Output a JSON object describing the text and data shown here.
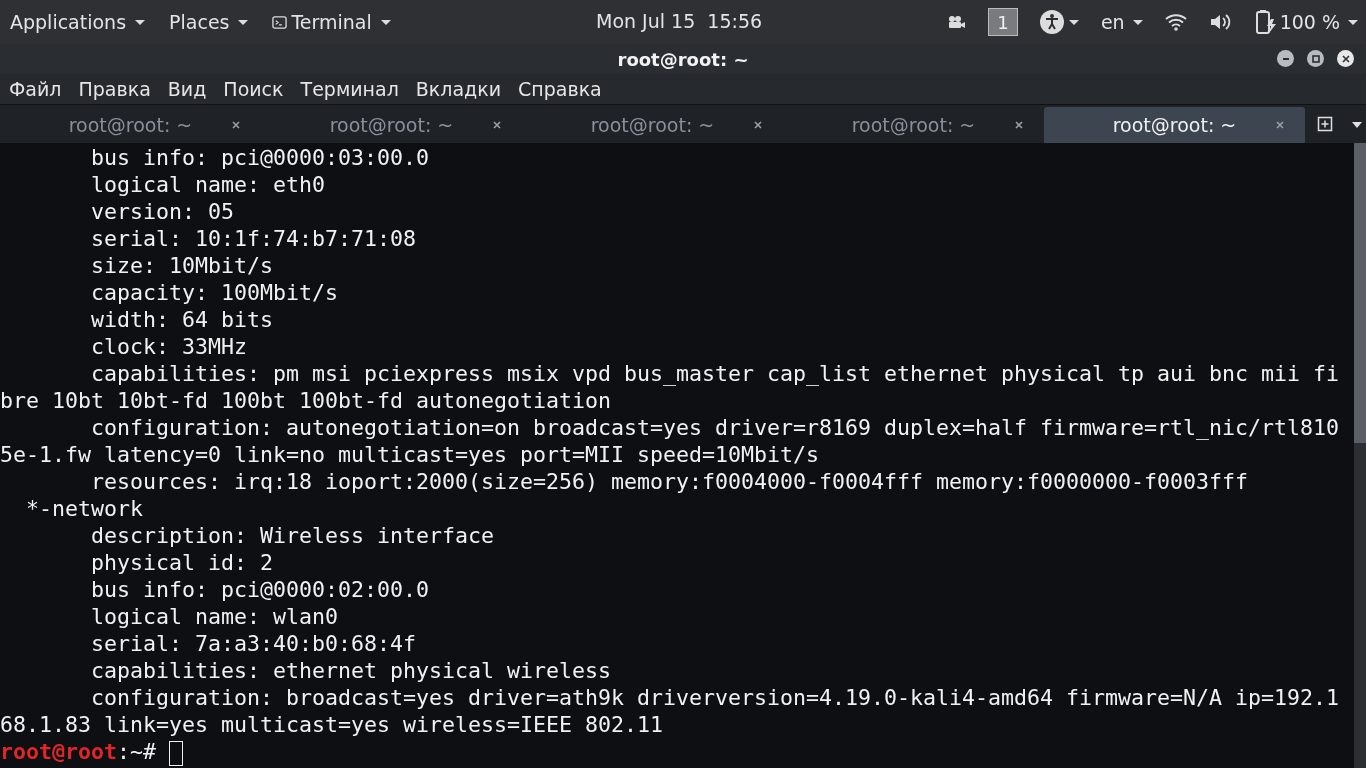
{
  "top_bar": {
    "menus": [
      {
        "label": "Applications"
      },
      {
        "label": "Places"
      },
      {
        "label": "Terminal",
        "icon": true
      }
    ],
    "clock": "Mon Jul 15  15:56",
    "workspace": "1",
    "language": "en",
    "battery": "100 %"
  },
  "window": {
    "title": "root@root: ~"
  },
  "menu_bar": [
    "Файл",
    "Правка",
    "Вид",
    "Поиск",
    "Терминал",
    "Вкладки",
    "Справка"
  ],
  "tabs": [
    {
      "label": "root@root: ~",
      "selected": false
    },
    {
      "label": "root@root: ~",
      "selected": false
    },
    {
      "label": "root@root: ~",
      "selected": false
    },
    {
      "label": "root@root: ~",
      "selected": false
    },
    {
      "label": "root@root: ~",
      "selected": true
    }
  ],
  "terminal": {
    "lines": [
      "       bus info: pci@0000:03:00.0",
      "       logical name: eth0",
      "       version: 05",
      "       serial: 10:1f:74:b7:71:08",
      "       size: 10Mbit/s",
      "       capacity: 100Mbit/s",
      "       width: 64 bits",
      "       clock: 33MHz",
      "       capabilities: pm msi pciexpress msix vpd bus_master cap_list ethernet physical tp aui bnc mii fi",
      "bre 10bt 10bt-fd 100bt 100bt-fd autonegotiation",
      "       configuration: autonegotiation=on broadcast=yes driver=r8169 duplex=half firmware=rtl_nic/rtl810",
      "5e-1.fw latency=0 link=no multicast=yes port=MII speed=10Mbit/s",
      "       resources: irq:18 ioport:2000(size=256) memory:f0004000-f0004fff memory:f0000000-f0003fff",
      "  *-network",
      "       description: Wireless interface",
      "       physical id: 2",
      "       bus info: pci@0000:02:00.0",
      "       logical name: wlan0",
      "       serial: 7a:a3:40:b0:68:4f",
      "       capabilities: ethernet physical wireless",
      "       configuration: broadcast=yes driver=ath9k driverversion=4.19.0-kali4-amd64 firmware=N/A ip=192.1",
      "68.1.83 link=yes multicast=yes wireless=IEEE 802.11"
    ],
    "prompt": {
      "user": "root@root",
      "path": ":~# "
    }
  }
}
